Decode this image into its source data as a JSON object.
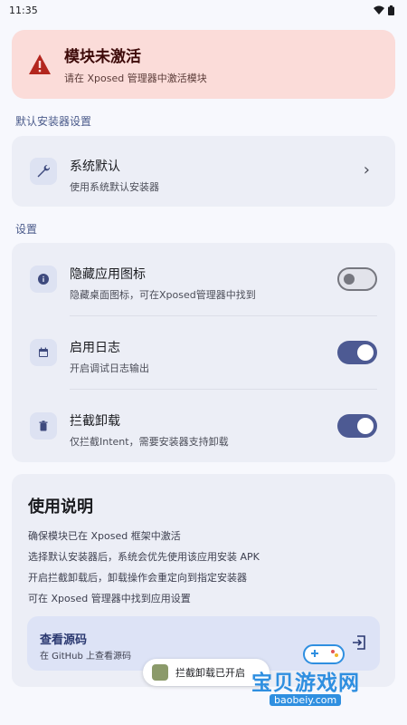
{
  "status_bar": {
    "time": "11:35"
  },
  "alert": {
    "title": "模块未激活",
    "subtitle": "请在 Xposed 管理器中激活模块",
    "icon": "warning-icon",
    "color": "#b3261e"
  },
  "installer_section": {
    "label": "默认安装器设置",
    "item": {
      "title": "系统默认",
      "subtitle": "使用系统默认安装器",
      "icon": "wrench-icon"
    }
  },
  "settings_section": {
    "label": "设置",
    "items": [
      {
        "title": "隐藏应用图标",
        "subtitle": "隐藏桌面图标，可在Xposed管理器中找到",
        "icon": "info-icon",
        "enabled": false
      },
      {
        "title": "启用日志",
        "subtitle": "开启调试日志输出",
        "icon": "calendar-icon",
        "enabled": true
      },
      {
        "title": "拦截卸载",
        "subtitle": "仅拦截Intent，需要安装器支持卸载",
        "icon": "trash-icon",
        "enabled": true
      }
    ]
  },
  "usage": {
    "title": "使用说明",
    "lines": [
      "确保模块已在 Xposed 框架中激活",
      "选择默认安装器后，系统会优先使用该应用安装 APK",
      "开启拦截卸载后，卸载操作会重定向到指定安装器",
      "可在 Xposed 管理器中找到应用设置"
    ],
    "source": {
      "title": "查看源码",
      "subtitle": "在 GitHub 上查看源码",
      "icon": "open-external-icon"
    }
  },
  "toast": {
    "text": "拦截卸载已开启"
  },
  "watermark": {
    "text": "宝贝游戏网",
    "url": "baobeiy.com"
  },
  "colors": {
    "accent": "#4d5a93",
    "alert_bg": "#fbdcd9",
    "card_bg": "#eceef6"
  }
}
